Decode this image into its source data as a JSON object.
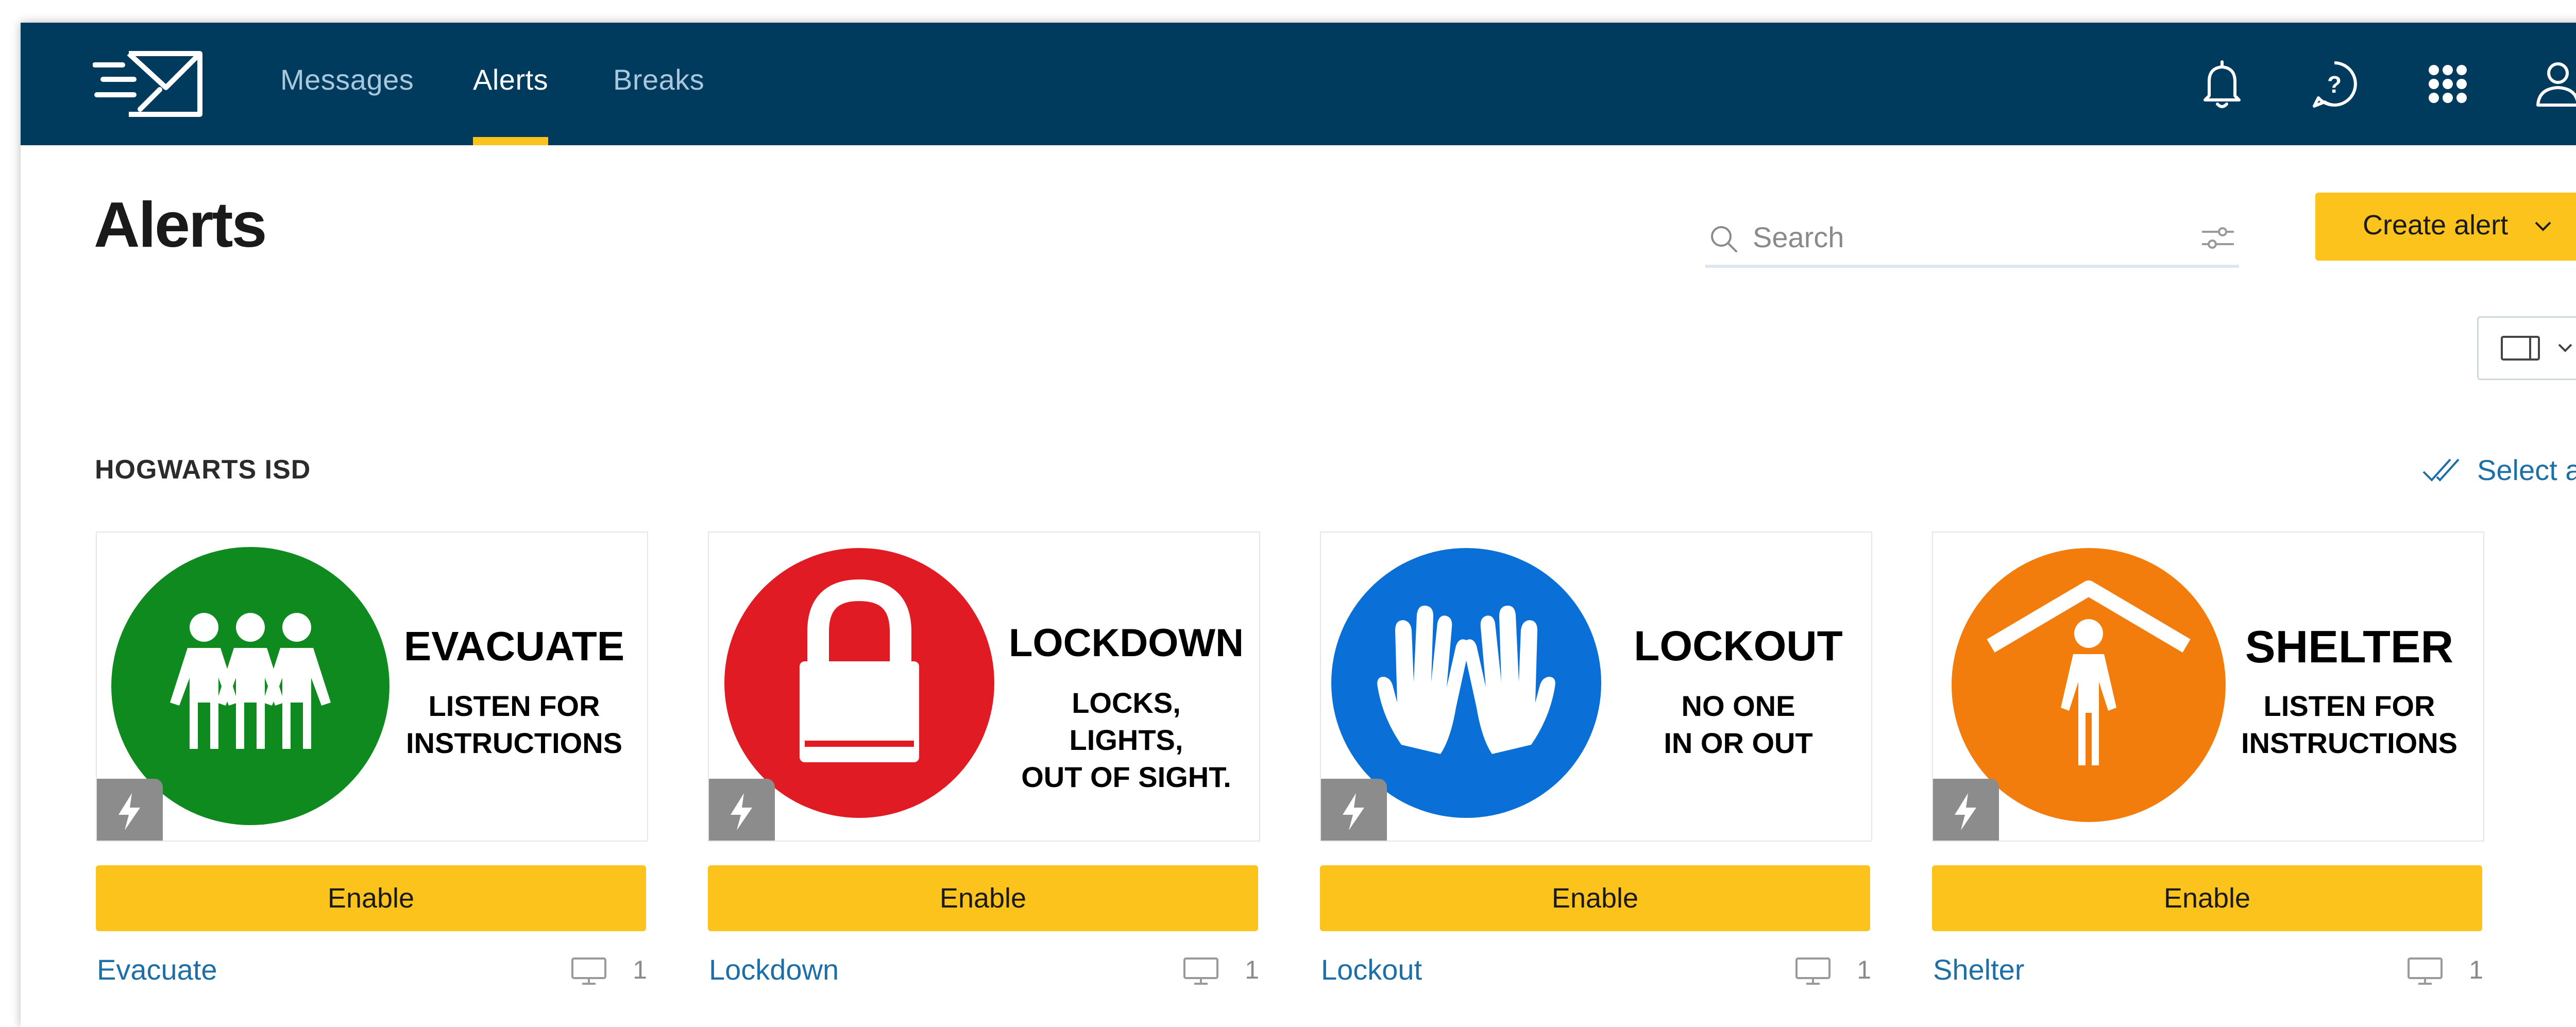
{
  "nav": {
    "links": [
      {
        "label": "Messages"
      },
      {
        "label": "Alerts"
      },
      {
        "label": "Breaks"
      }
    ],
    "active": "Alerts",
    "icons": [
      "bell-icon",
      "help-icon",
      "apps-grid-icon",
      "user-icon"
    ],
    "logo": "envelope-logo-icon"
  },
  "page": {
    "title": "Alerts"
  },
  "search": {
    "placeholder": "Search"
  },
  "toolbar": {
    "create_label": "Create alert"
  },
  "group": {
    "title": "HOGWARTS ISD",
    "select_all_label": "Select all"
  },
  "colors": {
    "nav_bg": "#003a5c",
    "accent": "#fbc31c",
    "link": "#1d6fa8",
    "evacuate": "#0f8a1f",
    "lockdown": "#e01b24",
    "lockout": "#0a6fd6",
    "shelter": "#f27d0c"
  },
  "cards": [
    {
      "name": "Evacuate",
      "enable_label": "Enable",
      "device_count": "1",
      "sign": {
        "heading": "EVACUATE",
        "lines": [
          "LISTEN FOR",
          "INSTRUCTIONS"
        ]
      }
    },
    {
      "name": "Lockdown",
      "enable_label": "Enable",
      "device_count": "1",
      "sign": {
        "heading": "LOCKDOWN",
        "lines": [
          "LOCKS,",
          "LIGHTS,",
          "OUT OF SIGHT."
        ]
      }
    },
    {
      "name": "Lockout",
      "enable_label": "Enable",
      "device_count": "1",
      "sign": {
        "heading": "LOCKOUT",
        "lines": [
          "NO ONE",
          "IN OR OUT"
        ]
      }
    },
    {
      "name": "Shelter",
      "enable_label": "Enable",
      "device_count": "1",
      "sign": {
        "heading": "SHELTER",
        "lines": [
          "LISTEN FOR",
          "INSTRUCTIONS"
        ]
      }
    }
  ]
}
